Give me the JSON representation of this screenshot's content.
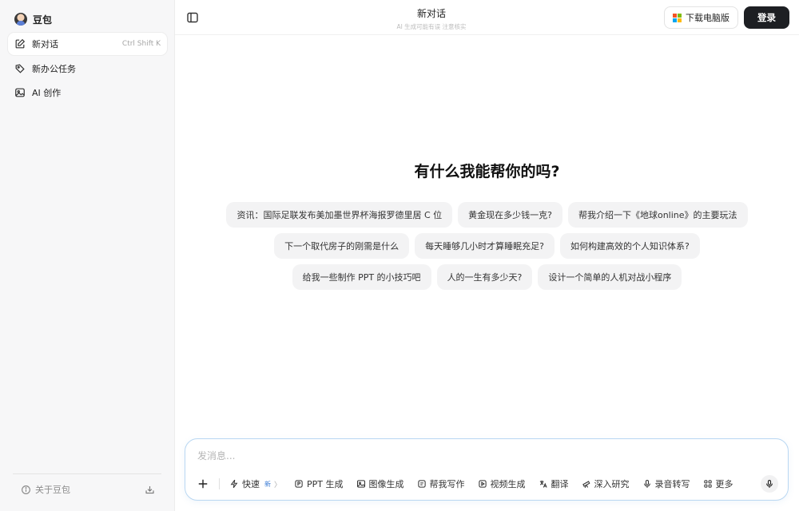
{
  "sidebar": {
    "brand": "豆包",
    "items": [
      {
        "label": "新对话",
        "shortcut": "Ctrl Shift K",
        "icon": "edit-icon"
      },
      {
        "label": "新办公任务",
        "icon": "tag-icon"
      },
      {
        "label": "AI 创作",
        "icon": "image-icon"
      }
    ],
    "about": "关于豆包"
  },
  "header": {
    "title": "新对话",
    "subtitle": "AI 生成可能有误 注意核实",
    "download_label": "下载电脑版",
    "login_label": "登录"
  },
  "main": {
    "headline": "有什么我能帮你的吗?",
    "suggestions": [
      [
        "资讯：国际足联发布美加墨世界杯海报罗德里居 C 位",
        "黄金现在多少钱一克?",
        "帮我介绍一下《地球online》的主要玩法"
      ],
      [
        "下一个取代房子的刚需是什么",
        "每天睡够几小时才算睡眠充足?",
        "如何构建高效的个人知识体系?"
      ],
      [
        "给我一些制作 PPT 的小技巧吧",
        "人的一生有多少天?",
        "设计一个简单的人机对战小程序"
      ]
    ]
  },
  "composer": {
    "placeholder": "发消息...",
    "tools": [
      {
        "label": "快速",
        "badge": "新",
        "chevron": "〉",
        "icon": "lightning-icon"
      },
      {
        "label": "PPT 生成",
        "icon": "ppt-icon"
      },
      {
        "label": "图像生成",
        "icon": "image-icon"
      },
      {
        "label": "帮我写作",
        "icon": "write-icon"
      },
      {
        "label": "视频生成",
        "icon": "video-icon"
      },
      {
        "label": "翻译",
        "icon": "translate-icon"
      },
      {
        "label": "深入研究",
        "icon": "telescope-icon"
      },
      {
        "label": "录音转写",
        "icon": "mic-icon"
      },
      {
        "label": "更多",
        "icon": "grid-icon"
      }
    ]
  },
  "colors": {
    "accent_border": "#b9d7f2",
    "login_bg": "#1d1f23",
    "new_badge": "#3a7bd5"
  }
}
